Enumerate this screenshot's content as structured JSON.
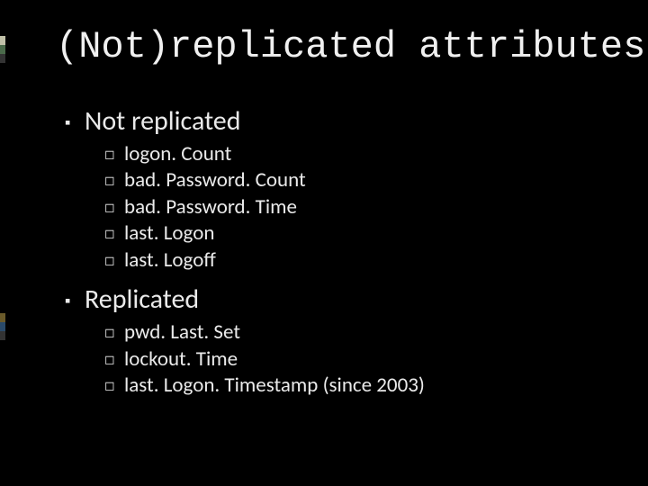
{
  "title": "(Not)replicated attributes",
  "sections": [
    {
      "heading": "Not replicated",
      "items": [
        "logon. Count",
        "bad. Password. Count",
        "bad. Password. Time",
        "last. Logon",
        "last. Logoff"
      ]
    },
    {
      "heading": "Replicated",
      "items": [
        "pwd. Last. Set",
        "lockout. Time",
        "last. Logon. Timestamp (since 2003)"
      ]
    }
  ]
}
